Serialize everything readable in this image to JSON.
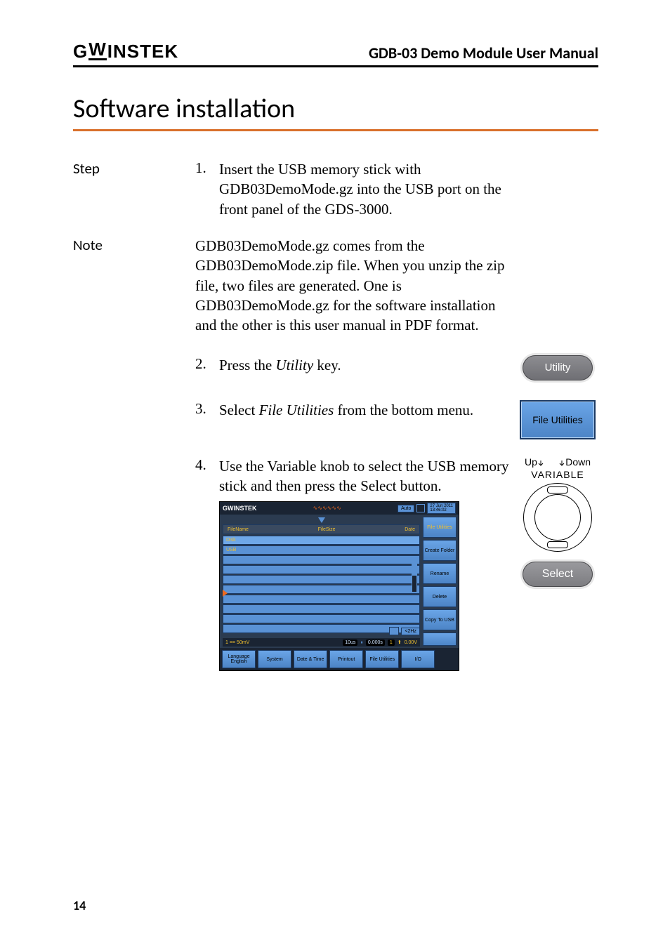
{
  "header": {
    "brand": "GWINSTEK",
    "manual_title": "GDB-03 Demo Module User Manual"
  },
  "section_title": "Software installation",
  "labels": {
    "step": "Step",
    "note": "Note"
  },
  "steps": {
    "s1_num": "1.",
    "s1_text": "Insert the USB memory stick with GDB03DemoMode.gz into the USB port on the front panel of the GDS-3000.",
    "note_text": "GDB03DemoMode.gz comes from the GDB03DemoMode.zip file. When you unzip the zip file, two files are generated. One is GDB03DemoMode.gz for the software installation and the other is this user manual in PDF format.",
    "s2_num": "2.",
    "s2_text_a": "Press the ",
    "s2_text_b": "Utility",
    "s2_text_c": " key.",
    "s3_num": "3.",
    "s3_text_a": "Select ",
    "s3_text_b": "File Utilities",
    "s3_text_c": " from the bottom menu.",
    "s4_num": "4.",
    "s4_text": "Use the Variable knob to select the USB memory stick and then press the Select button."
  },
  "buttons": {
    "utility": "Utility",
    "file_utilities": "File Utilities",
    "select": "Select"
  },
  "knob": {
    "up": "Up",
    "down": "Down",
    "label": "VARIABLE"
  },
  "screenshot": {
    "brand": "GWINSTEK",
    "auto": "Auto",
    "date1": "27 Jun 2011",
    "date2": "13:46:02",
    "col_name": "FileName",
    "col_size": "FileSize",
    "col_date": "Date",
    "row_disk": "Disk",
    "row_usb": "USB",
    "side_top": "File Utilities",
    "side1": "Create Folder",
    "side2": "Rename",
    "side3": "Delete",
    "side4": "Copy To USB",
    "status_left": "1 == 50mV",
    "status_mid_a": "10us",
    "status_mid_b": "0.000s",
    "status_right_a": "1",
    "status_right_b": "0.00V",
    "usb_freq": "<2Hz",
    "bottom1a": "Language",
    "bottom1b": "English",
    "bottom2": "System",
    "bottom3": "Date & Time",
    "bottom4": "Printout",
    "bottom5": "File Utilities",
    "bottom6": "I/O"
  },
  "page_number": "14"
}
